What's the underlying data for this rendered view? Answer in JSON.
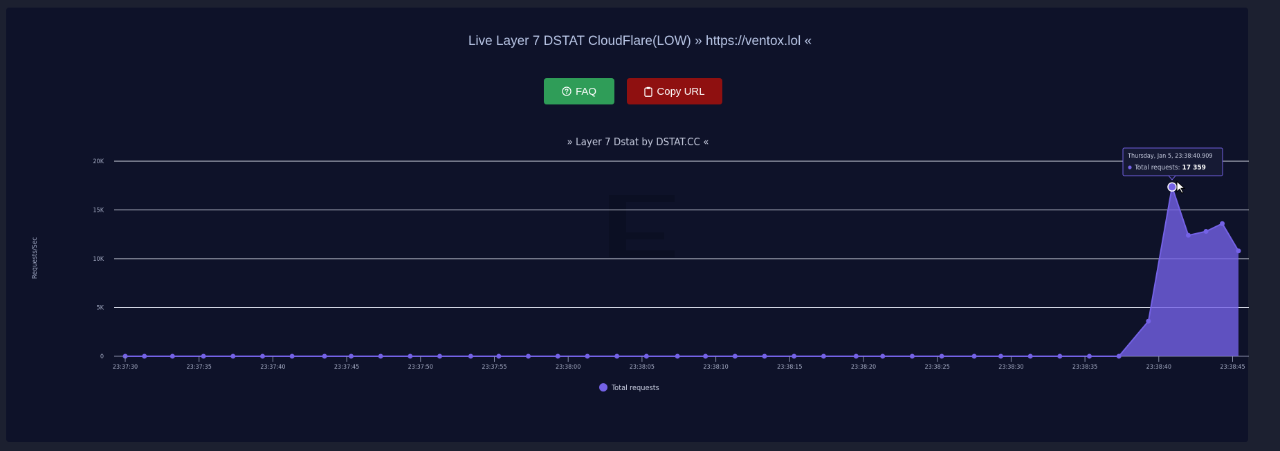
{
  "page": {
    "title": "Live Layer 7 DSTAT CloudFlare(LOW) » https://ventox.lol «"
  },
  "buttons": {
    "faq_label": "FAQ",
    "copy_label": "Copy URL"
  },
  "colors": {
    "series": "#7462e6",
    "faq_button": "#2f9d58",
    "copy_button": "#8f1010",
    "background": "#0e1229"
  },
  "icons": {
    "faq": "question-circle-icon",
    "copy": "clipboard-icon"
  },
  "chart_data": {
    "type": "area",
    "title": "» Layer 7 Dstat by DSTAT.CC «",
    "ylabel": "Requests/Sec",
    "xlabel": "",
    "ylim": [
      0,
      20000
    ],
    "y_ticks": [
      0,
      5000,
      10000,
      15000,
      20000
    ],
    "y_tick_labels": [
      "0",
      "5K",
      "10K",
      "15K",
      "20K"
    ],
    "x_range": [
      "23:37:30",
      "23:38:45.8"
    ],
    "x_tick_labels": [
      "23:37:30",
      "23:37:35",
      "23:37:40",
      "23:37:45",
      "23:37:50",
      "23:37:55",
      "23:38:00",
      "23:38:05",
      "23:38:10",
      "23:38:15",
      "23:38:20",
      "23:38:25",
      "23:38:30",
      "23:38:35",
      "23:38:40",
      "23:38:45"
    ],
    "grid": true,
    "legend_position": "bottom-center",
    "series": [
      {
        "name": "Total requests",
        "x": [
          "23:37:30.0",
          "23:37:31.3",
          "23:37:33.2",
          "23:37:35.3",
          "23:37:37.3",
          "23:37:39.3",
          "23:37:41.3",
          "23:37:43.5",
          "23:37:45.3",
          "23:37:47.3",
          "23:37:49.3",
          "23:37:51.3",
          "23:37:53.4",
          "23:37:55.3",
          "23:37:57.3",
          "23:37:59.3",
          "23:38:01.3",
          "23:38:03.3",
          "23:38:05.3",
          "23:38:07.4",
          "23:38:09.3",
          "23:38:11.3",
          "23:38:13.3",
          "23:38:15.3",
          "23:38:17.3",
          "23:38:19.5",
          "23:38:21.3",
          "23:38:23.3",
          "23:38:25.3",
          "23:38:27.5",
          "23:38:29.3",
          "23:38:31.3",
          "23:38:33.3",
          "23:38:35.3",
          "23:38:37.3",
          "23:38:39.3",
          "23:38:40.9",
          "23:38:42.0",
          "23:38:43.2",
          "23:38:44.3",
          "23:38:45.4"
        ],
        "y": [
          0,
          0,
          0,
          0,
          0,
          0,
          0,
          0,
          0,
          0,
          0,
          0,
          0,
          0,
          0,
          0,
          0,
          0,
          0,
          0,
          0,
          0,
          0,
          0,
          0,
          0,
          0,
          0,
          0,
          0,
          0,
          0,
          0,
          0,
          0,
          3600,
          17359,
          12400,
          12800,
          13600,
          10800
        ]
      }
    ],
    "tooltip": {
      "header": "Thursday, Jan 5, 23:38:40.909",
      "series_label": "Total requests:",
      "value_text": "17 359",
      "point_index": 36
    }
  }
}
